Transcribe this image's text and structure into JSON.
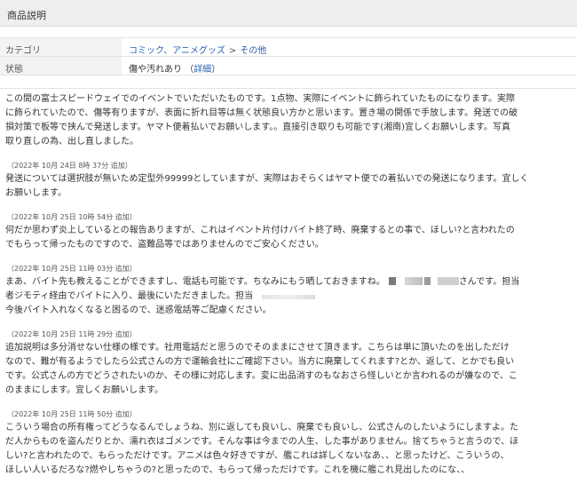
{
  "section_title": "商品説明",
  "specs": {
    "category_label": "カテゴリ",
    "category_path": [
      "コミック、アニメグッズ",
      "その他"
    ],
    "category_sep": ">",
    "condition_label": "状態",
    "condition_value": "傷や汚れあり",
    "condition_detail_open": "（",
    "condition_detail_link": "詳細",
    "condition_detail_close": "）"
  },
  "description": {
    "main": [
      "この間の富士スピードウェイでのイベントでいただいたものです。1点物、実際にイベントに飾られていたものになります。実際",
      "に飾られていたので、傷等有りますが、表面に折れ目等は無く状態良い方かと思います。置き場の関係で手放します。発送での破",
      "損対策で板等で挟んで発送します。ヤマト便着払いでお願いします。。直接引き取りも可能です(湘南)宜しくお願いします。写真",
      "取り直しの為、出し直しました。"
    ],
    "addenda": [
      {
        "stamp": "（2022年 10月 24日 8時 37分 追加）",
        "lines": [
          "発送については選択肢が無いため定型外99999としていますが、実際はおそらくはヤマト便での着払いでの発送になります。宜しく",
          "お願いします。"
        ]
      },
      {
        "stamp": "（2022年 10月 25日 10時 54分 追加）",
        "lines": [
          "何だか思わず炎上しているとの報告ありますが、これはイベント片付けバイト終了時、廃棄するとの事で、ほしい?と言われたの",
          "でもらって帰ったものですので、盗難品等ではありませんのでご安心ください。"
        ]
      },
      {
        "stamp": "（2022年 10月 25日 11時 03分 追加）",
        "line1_text": "まあ、バイト先も教えることができますし、電話も可能です。ちなみにもう晒しておきますね。",
        "line1_tail": "さんです。担当",
        "line2": "者ジモティ経由でバイトに入り、最後にいただきました。担当",
        "line3": "今後バイト入れなくなると困るので、迷惑電話等ご配慮ください。"
      },
      {
        "stamp": "（2022年 10月 25日 11時 29分 追加）",
        "lines": [
          "追加説明は多分消せない仕様の様です。社用電話だと思うのでそのままにさせて頂きます。こちらは単に頂いたのを出しただけ",
          "なので、難が有るようでしたら公式さんの方で運輸会社にご確認下さい。当方に廃棄してくれます?とか、返して、とかでも良い",
          "です。公式さんの方でどうされたいのか、その様に対応します。変に出品消すのもなおさら怪しいとか言われるのが嫌なので、こ",
          "のままにします。宜しくお願いします。"
        ]
      },
      {
        "stamp": "（2022年 10月 25日 11時 50分 追加）",
        "lines": [
          "こういう場合の所有権ってどうなるんでしょうね、別に返しても良いし、廃棄でも良いし、公式さんのしたいようにしますよ。た",
          "だ人からものを盗んだりとか、濡れ衣はゴメンです。そんな事は今までの人生、した事がありません。捨てちゃうと言うので、ほ",
          "しい?と言われたので、もらっただけです。アニメは色々好きですが、艦これは詳しくないなあ、、と思ったけど、こういうの、",
          "ほしい人いるだろな?燃やしちゃうの?と思ったので、もらって帰っただけです。これを機に艦これ見出したのにな、、"
        ]
      }
    ]
  }
}
